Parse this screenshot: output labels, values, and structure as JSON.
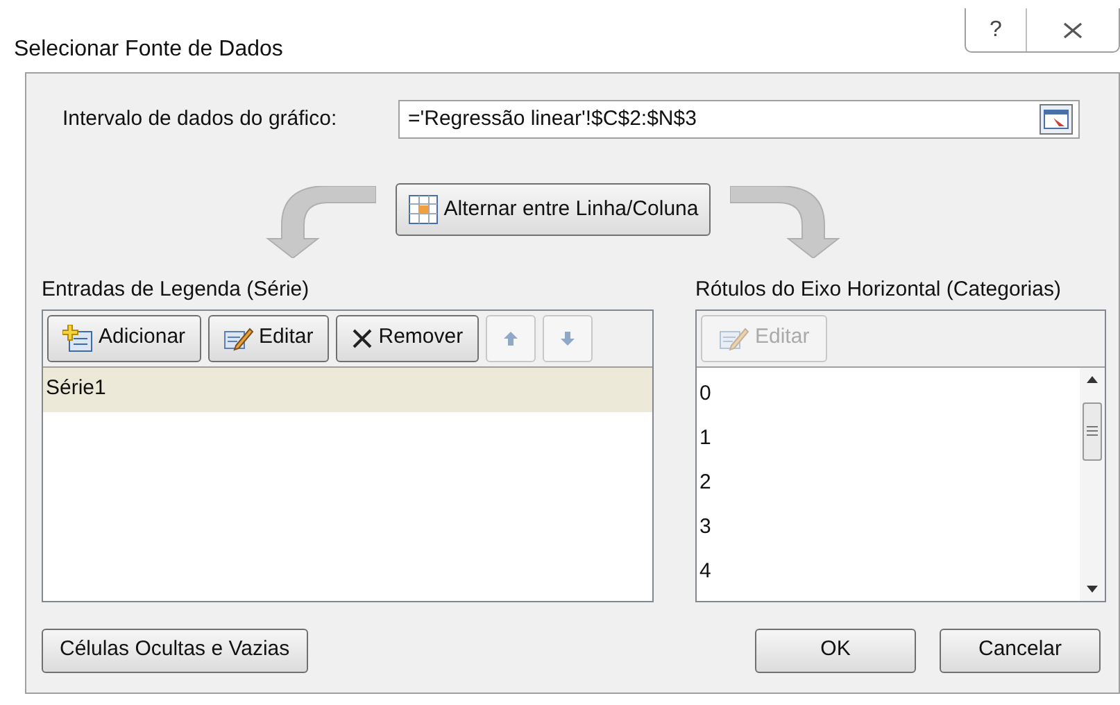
{
  "window": {
    "title": "Selecionar Fonte de Dados",
    "help": "?"
  },
  "range": {
    "label": "Intervalo de dados do gráfico:",
    "value": "='Regressão linear'!$C$2:$N$3"
  },
  "switch_button": "Alternar entre Linha/Coluna",
  "series_panel": {
    "title": "Entradas de Legenda (Série)",
    "toolbar": [
      {
        "kind": "add",
        "label": "Adicionar",
        "disabled": false
      },
      {
        "kind": "edit",
        "label": "Editar",
        "disabled": false
      },
      {
        "kind": "remove",
        "label": "Remover",
        "disabled": false
      },
      {
        "kind": "up",
        "disabled": true
      },
      {
        "kind": "down",
        "disabled": true
      }
    ],
    "items": [
      {
        "label": "Série1",
        "selected": true
      }
    ]
  },
  "categories_panel": {
    "title": "Rótulos do Eixo Horizontal (Categorias)",
    "edit_button": {
      "label": "Editar",
      "disabled": true
    },
    "items": [
      {
        "label": "0"
      },
      {
        "label": "1"
      },
      {
        "label": "2"
      },
      {
        "label": "3"
      },
      {
        "label": "4"
      }
    ]
  },
  "buttons": {
    "hidden_cells": "Células Ocultas e Vazias",
    "ok": "OK",
    "cancel": "Cancelar"
  }
}
